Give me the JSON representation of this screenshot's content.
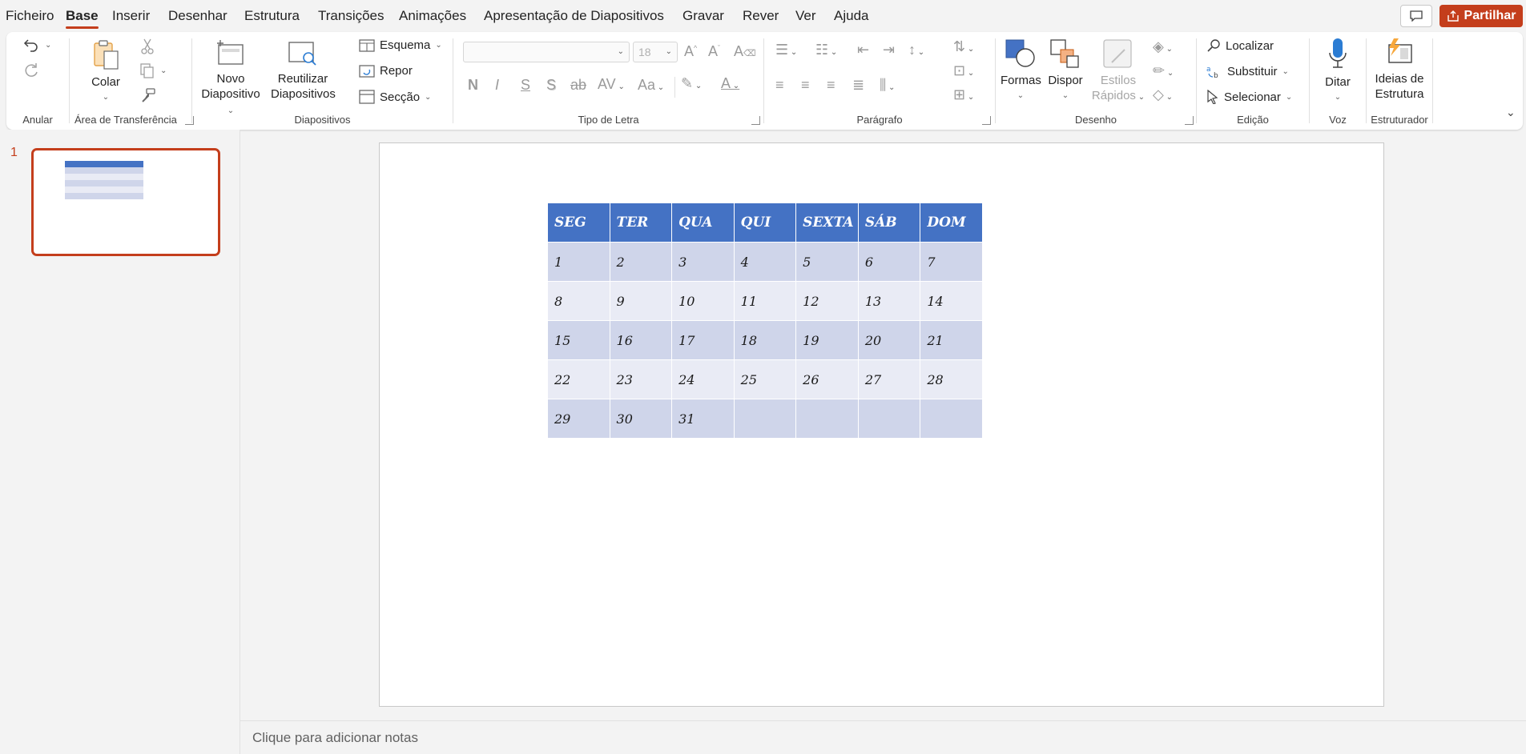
{
  "menu": {
    "items": [
      "Ficheiro",
      "Base",
      "Inserir",
      "Desenhar",
      "Estrutura",
      "Transições",
      "Animações",
      "Apresentação de Diapositivos",
      "Gravar",
      "Rever",
      "Ver",
      "Ajuda"
    ],
    "share_label": "Partilhar"
  },
  "ribbon": {
    "undo_group": "Anular",
    "clipboard": {
      "label": "Área de Transferência",
      "paste": "Colar"
    },
    "slides": {
      "label": "Diapositivos",
      "new_slide_1": "Novo",
      "new_slide_2": "Diapositivo",
      "reuse_1": "Reutilizar",
      "reuse_2": "Diapositivos",
      "layout": "Esquema",
      "reset": "Repor",
      "section": "Secção"
    },
    "font": {
      "label": "Tipo de Letra",
      "size": "18",
      "bold": "N",
      "italic": "I",
      "underline": "S",
      "shadow": "S",
      "strike": "ab",
      "case": "Aa"
    },
    "paragraph": {
      "label": "Parágrafo"
    },
    "drawing": {
      "label": "Desenho",
      "shapes": "Formas",
      "arrange": "Dispor",
      "quick_styles_1": "Estilos",
      "quick_styles_2": "Rápidos"
    },
    "editing": {
      "label": "Edição",
      "find": "Localizar",
      "replace": "Substituir",
      "select": "Selecionar"
    },
    "voice": {
      "label": "Voz",
      "dictate": "Ditar"
    },
    "designer": {
      "label": "Estruturador",
      "ideas_1": "Ideias de",
      "ideas_2": "Estrutura"
    }
  },
  "thumbnails": {
    "slide_number": "1"
  },
  "calendar": {
    "headers": [
      "SEG",
      "TER",
      "QUA",
      "QUI",
      "SEXTA",
      "SÁB",
      "DOM"
    ],
    "rows": [
      [
        "1",
        "2",
        "3",
        "4",
        "5",
        "6",
        "7"
      ],
      [
        "8",
        "9",
        "10",
        "11",
        "12",
        "13",
        "14"
      ],
      [
        "15",
        "16",
        "17",
        "18",
        "19",
        "20",
        "21"
      ],
      [
        "22",
        "23",
        "24",
        "25",
        "26",
        "27",
        "28"
      ],
      [
        "29",
        "30",
        "31",
        "",
        "",
        "",
        ""
      ]
    ]
  },
  "notes": {
    "placeholder": "Clique para adicionar notas"
  }
}
